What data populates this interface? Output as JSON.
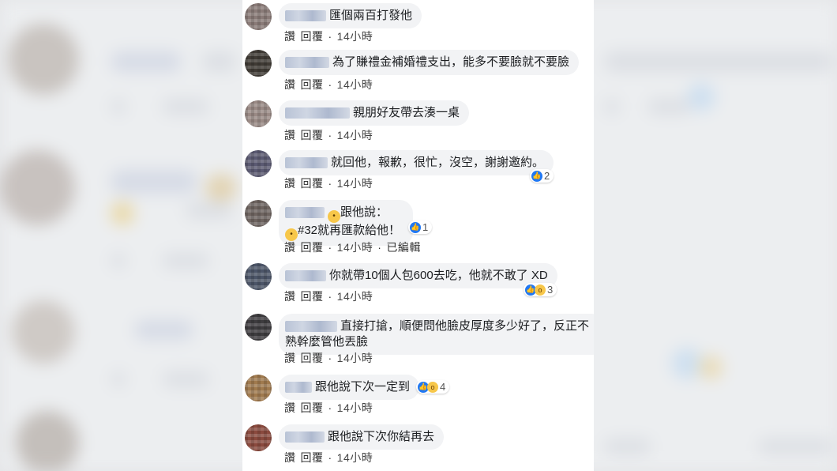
{
  "colors": {
    "like": "#2078f4",
    "wow": "#f7c74a",
    "bubble": "#f2f3f5"
  },
  "comments": [
    {
      "text": "匯個兩百打發他",
      "actions": {
        "like": "讚",
        "reply": "回覆",
        "time": "14小時"
      }
    },
    {
      "text": "為了賺禮金補婚禮支出，能多不要臉就不要臉",
      "actions": {
        "like": "讚",
        "reply": "回覆",
        "time": "14小時"
      }
    },
    {
      "text": "親朋好友帶去湊一桌",
      "actions": {
        "like": "讚",
        "reply": "回覆",
        "time": "14小時"
      }
    },
    {
      "text": "就回他，報歉，很忙，沒空，謝謝邀約。",
      "actions": {
        "like": "讚",
        "reply": "回覆",
        "time": "14小時"
      },
      "reaction_count": "2"
    },
    {
      "text": "跟他說：",
      "text2": "#32就再匯款給他！",
      "actions": {
        "like": "讚",
        "reply": "回覆",
        "time": "14小時",
        "edited": "已編輯"
      },
      "reaction_count": "1"
    },
    {
      "text": "你就帶10個人包600去吃，他就不敢了 XD",
      "actions": {
        "like": "讚",
        "reply": "回覆",
        "time": "14小時"
      },
      "reaction_count": "3"
    },
    {
      "text": "直接打搶，順便問他臉皮厚度多少好了，反正不熟幹麼管他丟臉",
      "actions": {
        "like": "讚",
        "reply": "回覆",
        "time": "14小時"
      }
    },
    {
      "text": "跟他說下次一定到",
      "actions": {
        "like": "讚",
        "reply": "回覆",
        "time": "14小時"
      },
      "reaction_count": "4"
    },
    {
      "text": "跟他說下次你結再去",
      "actions": {
        "like": "讚",
        "reply": "回覆",
        "time": "14小時"
      }
    }
  ]
}
